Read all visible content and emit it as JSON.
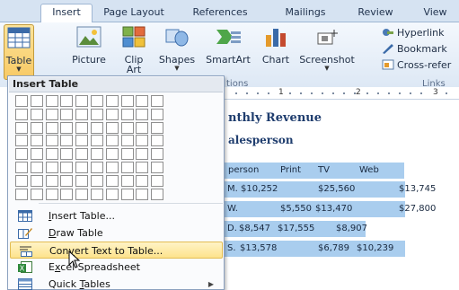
{
  "ribbon": {
    "tabs": [
      {
        "label": "Insert",
        "active": true
      },
      {
        "label": "Page Layout",
        "active": false
      },
      {
        "label": "References",
        "active": false
      },
      {
        "label": "Mailings",
        "active": false
      },
      {
        "label": "Review",
        "active": false
      },
      {
        "label": "View",
        "active": false
      }
    ],
    "buttons": {
      "table": "Table",
      "picture": "Picture",
      "clip_art": "Clip Art",
      "shapes": "Shapes",
      "smartart": "SmartArt",
      "chart": "Chart",
      "screenshot": "Screenshot"
    },
    "group_labels": {
      "illustrations": "tions",
      "links": "Links"
    },
    "links": {
      "hyperlink": "Hyperlink",
      "bookmark": "Bookmark",
      "cross_reference": "Cross-refer"
    }
  },
  "dropdown": {
    "title": "Insert Table",
    "grid": {
      "columns": 10,
      "rows": 8
    },
    "menu": [
      {
        "pre": "",
        "key": "I",
        "post": "nsert Table...",
        "icon": "insert-table-icon",
        "highlighted": false,
        "submenu": false
      },
      {
        "pre": "",
        "key": "D",
        "post": "raw Table",
        "icon": "draw-table-icon",
        "highlighted": false,
        "submenu": false
      },
      {
        "pre": "Con",
        "key": "v",
        "post": "ert Text to Table...",
        "icon": "convert-text-icon",
        "highlighted": true,
        "submenu": false
      },
      {
        "pre": "E",
        "key": "x",
        "post": "cel Spreadsheet",
        "icon": "excel-icon",
        "highlighted": false,
        "submenu": false
      },
      {
        "pre": "Quick ",
        "key": "T",
        "post": "ables",
        "icon": "quick-tables-icon",
        "highlighted": false,
        "submenu": true
      }
    ]
  },
  "ruler": {
    "numbers": [
      "1",
      "2",
      "3"
    ]
  },
  "document": {
    "heading1": "nthly Revenue",
    "heading2": "alesperson",
    "rows": [
      [
        "person",
        "Print",
        "TV",
        "Web"
      ],
      [
        "M.",
        "$10,252",
        "$25,560",
        "$13,745"
      ],
      [
        "W.",
        "$5,550",
        "$13,470",
        "$27,800"
      ],
      [
        "D.",
        "$8,547",
        "$17,555",
        "$8,907"
      ],
      [
        "S.",
        "$13,578",
        "$6,789",
        "$10,239"
      ]
    ]
  },
  "colors": {
    "ribbon_bg": "#dde8f5",
    "selection": "#a9cdee",
    "highlight": "#fde38c",
    "heading": "#1f3d6e"
  }
}
